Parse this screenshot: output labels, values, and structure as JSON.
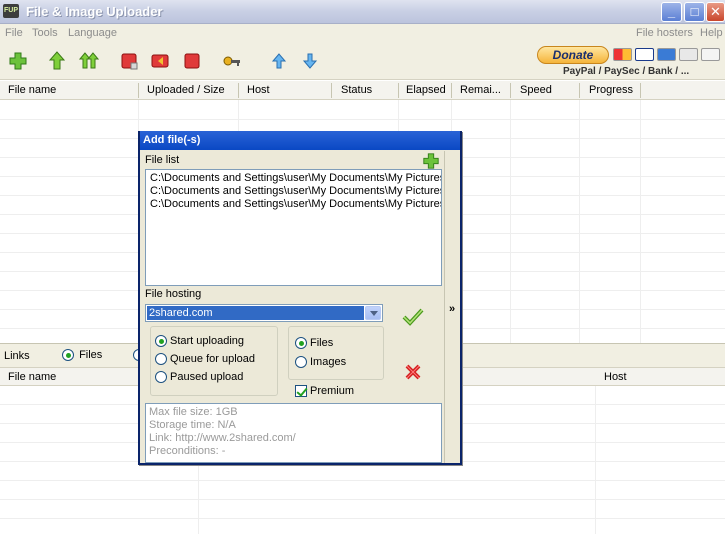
{
  "window": {
    "title": "File & Image Uploader",
    "icon_text": "FUP",
    "min_glyph": "_",
    "max_glyph": "□",
    "close_glyph": "✕"
  },
  "menu": {
    "file": "File",
    "tools": "Tools",
    "language": "Language",
    "file_hosters": "File hosters",
    "help": "Help"
  },
  "toolbar": {
    "icons": [
      "add-icon",
      "upload-icon",
      "upload-all-icon",
      "stop-icon",
      "stop-all-icon",
      "remove-icon",
      "key-icon",
      "move-up-icon",
      "move-down-icon"
    ],
    "donate_label": "Donate",
    "payment_text": "PayPal / PaySec / Bank / ..."
  },
  "grid": {
    "columns": [
      "File name",
      "Uploaded / Size",
      "Host",
      "Status",
      "Elapsed",
      "Remai...",
      "Speed",
      "Progress"
    ]
  },
  "links": {
    "label": "Links",
    "files_option": "Files",
    "columns": [
      "File name",
      "Host"
    ]
  },
  "dialog": {
    "title": "Add file(-s)",
    "file_list_label": "File list",
    "files": [
      "C:\\Documents and Settings\\user\\My Documents\\My Pictures\\",
      "C:\\Documents and Settings\\user\\My Documents\\My Pictures\\",
      "C:\\Documents and Settings\\user\\My Documents\\My Pictures\\"
    ],
    "file_hosting_label": "File hosting",
    "host_selected": "2shared.com",
    "mode_options": [
      "Start uploading",
      "Queue for upload",
      "Paused upload"
    ],
    "type_options": [
      "Files",
      "Images"
    ],
    "premium_label": "Premium",
    "info_lines": [
      "Max file size: 1GB",
      "Storage time: N/A",
      "Link: http://www.2shared.com/",
      "Preconditions: -"
    ],
    "expand_glyph": "»"
  },
  "colors": {
    "dialog_title": "#0a48c4",
    "selection": "#316ac5",
    "face": "#ece9d8"
  }
}
